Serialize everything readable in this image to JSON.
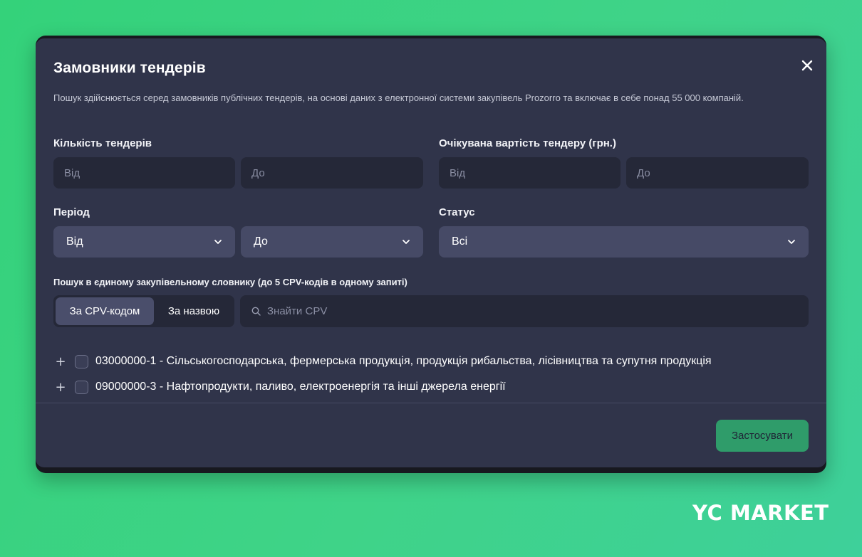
{
  "modal": {
    "title": "Замовники тендерів",
    "description": "Пошук здійснюється серед замовників публічних тендерів, на основі даних з електронної системи закупівель Prozorro та включає в себе понад 55 000 компаній."
  },
  "tender_count": {
    "label": "Кількість тендерів",
    "from_placeholder": "Від",
    "to_placeholder": "До"
  },
  "expected_value": {
    "label": "Очікувана вартість тендеру (грн.)",
    "from_placeholder": "Від",
    "to_placeholder": "До"
  },
  "period": {
    "label": "Період",
    "from_value": "Від",
    "to_value": "До"
  },
  "status": {
    "label": "Статус",
    "value": "Всі"
  },
  "cpv_search": {
    "label": "Пошук в єдиному закупівельному словнику (до 5 CPV-кодів в одному запиті)",
    "toggle_by_code": "За CPV-кодом",
    "toggle_by_name": "За назвою",
    "search_placeholder": "Знайти CPV",
    "items": [
      {
        "expand": "+",
        "label": "03000000-1 - Сільськогосподарська, фермерська продукція, продукція рибальства, лісівництва та супутня продукція"
      },
      {
        "expand": "+",
        "label": "09000000-3 - Нафтопродукти, паливо, електроенергія та інші джерела енергії"
      }
    ]
  },
  "apply_button": "Застосувати",
  "brand": {
    "logo_text": "YC MARKET",
    "accent_color": "#2f9c6a",
    "background_color": "#38d17f"
  }
}
